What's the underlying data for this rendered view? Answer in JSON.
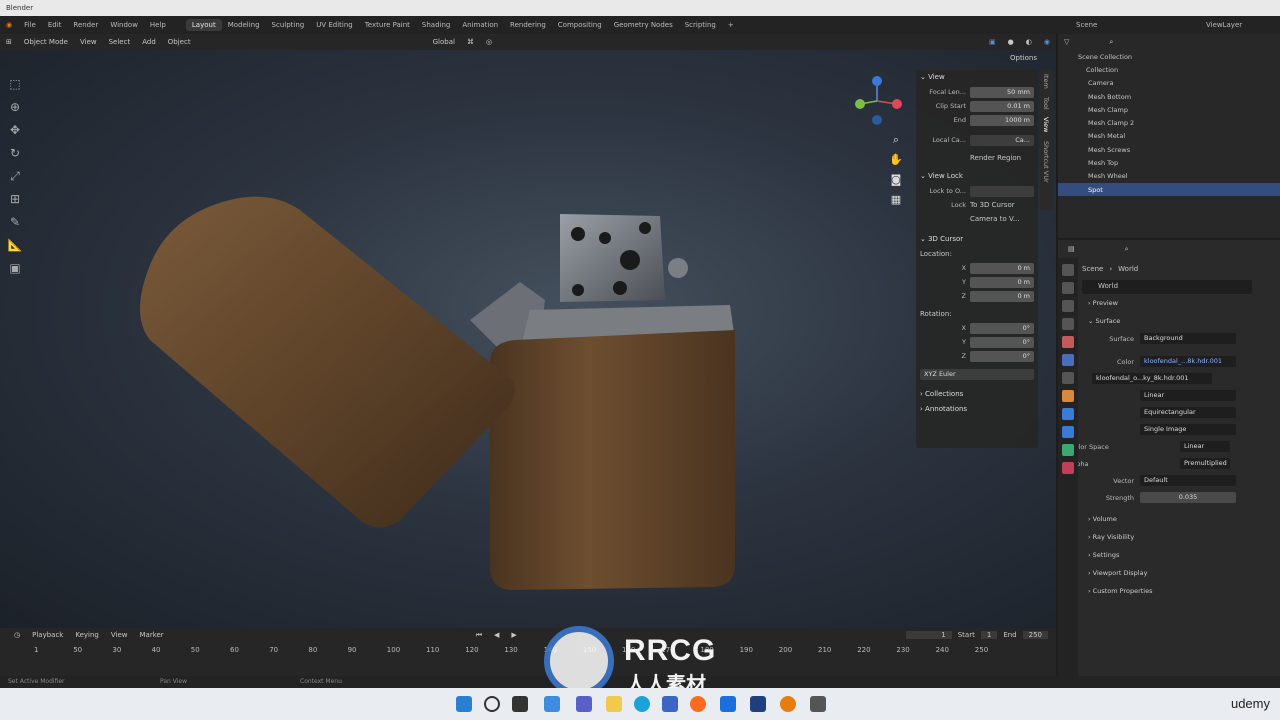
{
  "window": {
    "title": "Blender"
  },
  "menu": {
    "items": [
      "File",
      "Edit",
      "Render",
      "Window",
      "Help"
    ],
    "workspaces": [
      "Layout",
      "Modeling",
      "Sculpting",
      "UV Editing",
      "Texture Paint",
      "Shading",
      "Animation",
      "Rendering",
      "Compositing",
      "Geometry Nodes",
      "Scripting"
    ],
    "active_workspace": "Layout",
    "scene": "Scene",
    "view_layer": "ViewLayer"
  },
  "viewport_header": {
    "mode": "Object Mode",
    "menus": [
      "View",
      "Select",
      "Add",
      "Object"
    ],
    "transform": "Global",
    "options": "Options"
  },
  "npanel": {
    "tabs": [
      "Item",
      "Tool",
      "View",
      "Shortcut VUr"
    ],
    "view": {
      "title": "View",
      "focal_label": "Focal Len...",
      "focal_value": "50 mm",
      "clip_start_label": "Clip Start",
      "clip_start_value": "0.01 m",
      "end_label": "End",
      "end_value": "1000 m",
      "local_camera_label": "Local Ca...",
      "local_camera_value": "Ca...",
      "render_region": "Render Region"
    },
    "view_lock": {
      "title": "View Lock",
      "lock_to_label": "Lock to O...",
      "lock_label": "Lock",
      "to_3d_cursor": "To 3D Cursor",
      "camera_to_view": "Camera to V..."
    },
    "cursor": {
      "title": "3D Cursor",
      "location_label": "Location:",
      "x_label": "X",
      "x_value": "0 m",
      "y_label": "Y",
      "y_value": "0 m",
      "z_label": "Z",
      "z_value": "0 m",
      "rotation_label": "Rotation:",
      "rx_value": "0°",
      "ry_value": "0°",
      "rz_value": "0°",
      "rotation_mode": "XYZ Euler"
    },
    "collections": "Collections",
    "annotations": "Annotations"
  },
  "outliner": {
    "root": "Scene Collection",
    "collection": "Collection",
    "items": [
      "Camera",
      "Mesh Bottom",
      "Mesh Clamp",
      "Mesh Clamp 2",
      "Mesh Metal",
      "Mesh Screws",
      "Mesh Top",
      "Mesh Wheel",
      "Spot"
    ],
    "selected": "Spot"
  },
  "properties": {
    "breadcrumb_scene": "Scene",
    "breadcrumb_world": "World",
    "world_name": "World",
    "sections": {
      "preview": "Preview",
      "surface": "Surface"
    },
    "surface_label": "Surface",
    "surface_value": "Background",
    "color_label": "Color",
    "color_value": "kloofendal_...8k.hdr.001",
    "image_name": "kloofendal_o...ky_8k.hdr.001",
    "interp": "Linear",
    "projection": "Equirectangular",
    "source": "Single Image",
    "color_space_label": "Color Space",
    "color_space_value": "Linear",
    "alpha_label": "Alpha",
    "alpha_value": "Premultiplied",
    "vector_label": "Vector",
    "vector_value": "Default",
    "strength_label": "Strength",
    "strength_value": "0.035",
    "collapsed": [
      "Volume",
      "Ray Visibility",
      "Settings",
      "Viewport Display",
      "Custom Properties"
    ]
  },
  "timeline": {
    "menus": [
      "Playback",
      "Keying",
      "View",
      "Marker"
    ],
    "current_frame": "1",
    "start_label": "Start",
    "start_value": "1",
    "end_label": "End",
    "end_value": "250",
    "ticks": [
      "1",
      "50",
      "30",
      "40",
      "50",
      "60",
      "70",
      "80",
      "90",
      "100",
      "110",
      "120",
      "130",
      "140",
      "150",
      "160",
      "170",
      "180",
      "190",
      "200",
      "210",
      "220",
      "230",
      "240",
      "250"
    ]
  },
  "statusbar": {
    "left": "Set Active Modifier",
    "mid": "Pan View",
    "right": "Context Menu"
  },
  "watermark": {
    "brand": "RRCG",
    "sub": "人人素材"
  },
  "udemy": "udemy",
  "colors": {
    "accent": "#334d80",
    "wood": "#6b4a2e",
    "metal": "#8a8d91"
  }
}
